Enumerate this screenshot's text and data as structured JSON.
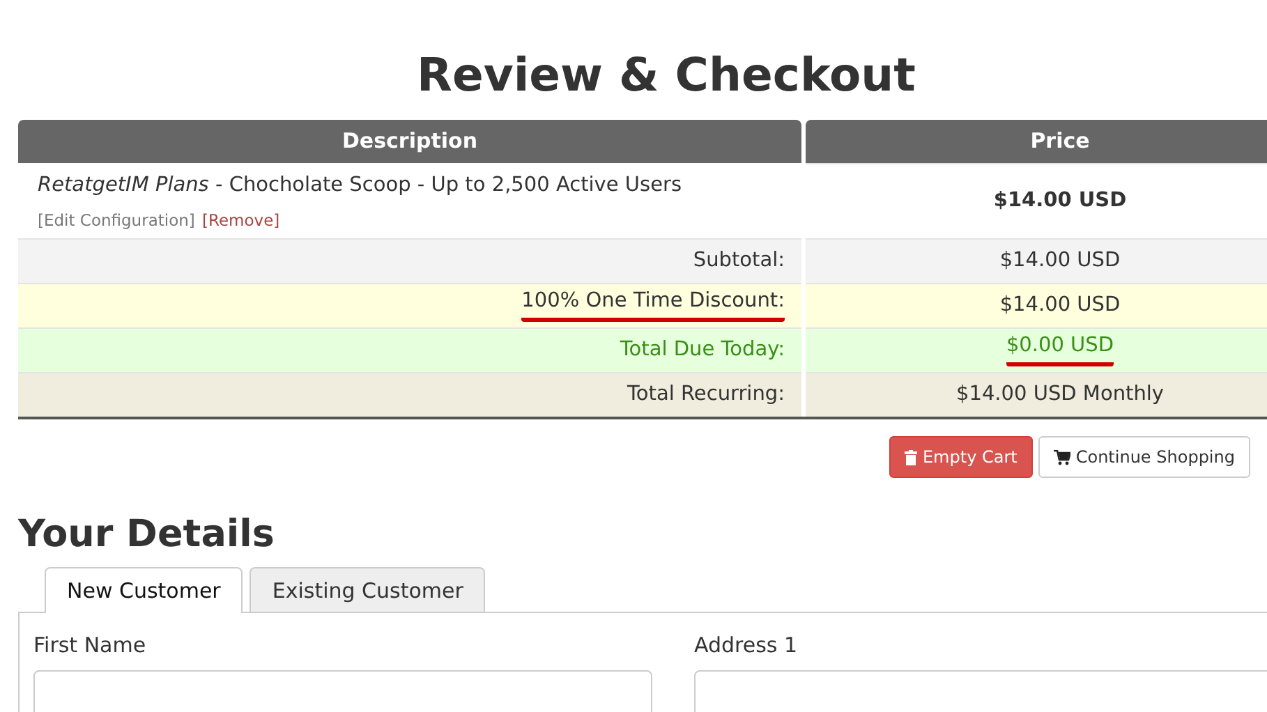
{
  "title": "Review & Checkout",
  "cart": {
    "columns": [
      "Description",
      "Price"
    ],
    "item": {
      "group": "RetatgetIM Plans",
      "name": " - Chocholate Scoop - Up to 2,500 Active Users",
      "edit_link": "[Edit Configuration]",
      "remove_link": "[Remove]",
      "price": "$14.00 USD"
    },
    "summary": [
      {
        "kind": "subtotal",
        "label": "Subtotal:",
        "value": "$14.00 USD",
        "label_underlined": false,
        "value_underlined": false
      },
      {
        "kind": "discount",
        "label": "100% One Time Discount:",
        "value": "$14.00 USD",
        "label_underlined": true,
        "value_underlined": false
      },
      {
        "kind": "due",
        "label": "Total Due Today:",
        "value": "$0.00 USD",
        "label_underlined": false,
        "value_underlined": true
      },
      {
        "kind": "recurring",
        "label": "Total Recurring:",
        "value": "$14.00 USD Monthly",
        "label_underlined": false,
        "value_underlined": false
      }
    ],
    "buttons": [
      {
        "kind": "empty",
        "label": "Empty Cart"
      },
      {
        "kind": "continue",
        "label": "Continue Shopping"
      }
    ]
  },
  "details": {
    "heading": "Your Details",
    "tabs": [
      {
        "label": "New Customer",
        "selected": true
      },
      {
        "label": "Existing Customer",
        "selected": false
      }
    ],
    "fields": [
      {
        "label": "First Name"
      },
      {
        "label": "Address 1"
      }
    ]
  }
}
